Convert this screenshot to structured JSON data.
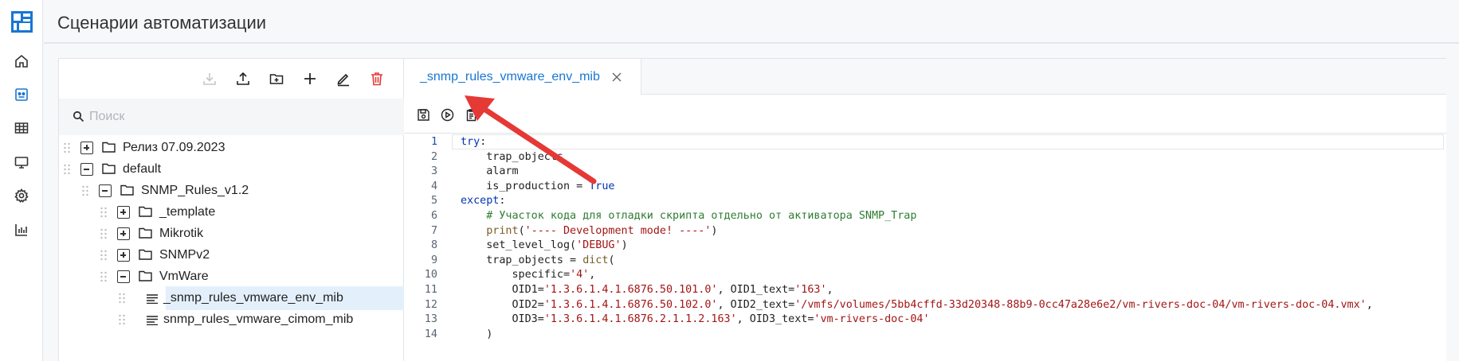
{
  "header": {
    "title": "Сценарии автоматизации"
  },
  "rail": {
    "items": [
      {
        "icon": "home-icon"
      },
      {
        "icon": "scripts-icon",
        "active": true
      },
      {
        "icon": "table-icon"
      },
      {
        "icon": "monitor-icon"
      },
      {
        "icon": "gear-icon"
      },
      {
        "icon": "chart-icon"
      }
    ]
  },
  "tree_toolbar": {
    "buttons": [
      "download-icon",
      "upload-icon",
      "new-folder-icon",
      "add-icon",
      "edit-icon",
      "delete-icon"
    ]
  },
  "search": {
    "placeholder": "Поиск"
  },
  "tree": {
    "items": [
      {
        "label": "Релиз 07.09.2023",
        "depth": 0,
        "expanded": false,
        "type": "folder"
      },
      {
        "label": "default",
        "depth": 0,
        "expanded": true,
        "type": "folder"
      },
      {
        "label": "SNMP_Rules_v1.2",
        "depth": 1,
        "expanded": true,
        "type": "folder"
      },
      {
        "label": "_template",
        "depth": 2,
        "expanded": false,
        "type": "folder"
      },
      {
        "label": "Mikrotik",
        "depth": 2,
        "expanded": false,
        "type": "folder"
      },
      {
        "label": "SNMPv2",
        "depth": 2,
        "expanded": false,
        "type": "folder"
      },
      {
        "label": "VmWare",
        "depth": 2,
        "expanded": true,
        "type": "folder"
      },
      {
        "label": "_snmp_rules_vmware_env_mib",
        "depth": 3,
        "type": "file",
        "selected": true
      },
      {
        "label": "snmp_rules_vmware_cimom_mib",
        "depth": 3,
        "type": "file"
      }
    ]
  },
  "editor": {
    "tab": {
      "label": "_snmp_rules_vmware_env_mib"
    },
    "toolbar": [
      "save-icon",
      "run-icon",
      "clipboard-icon"
    ],
    "current_line": 1,
    "lines": [
      {
        "n": "1",
        "code": "try:"
      },
      {
        "n": "2",
        "code": "    trap_objects"
      },
      {
        "n": "3",
        "code": "    alarm"
      },
      {
        "n": "4",
        "code": "    is_production = True"
      },
      {
        "n": "5",
        "code": "except:"
      },
      {
        "n": "6",
        "code": "    # Участок кода для отладки скрипта отдельно от активатора SNMP_Trap"
      },
      {
        "n": "7",
        "code": "    print('---- Development mode! ----')"
      },
      {
        "n": "8",
        "code": "    set_level_log('DEBUG')"
      },
      {
        "n": "9",
        "code": "    trap_objects = dict("
      },
      {
        "n": "10",
        "code": "        specific='4',"
      },
      {
        "n": "11",
        "code": "        OID1='1.3.6.1.4.1.6876.50.101.0', OID1_text='163',"
      },
      {
        "n": "12",
        "code": "        OID2='1.3.6.1.4.1.6876.50.102.0', OID2_text='/vmfs/volumes/5bb4cffd-33d20348-88b9-0cc47a28e6e2/vm-rivers-doc-04/vm-rivers-doc-04.vmx',"
      },
      {
        "n": "13",
        "code": "        OID3='1.3.6.1.4.1.6876.2.1.1.2.163', OID3_text='vm-rivers-doc-04'"
      },
      {
        "n": "14",
        "code": "    )"
      }
    ]
  },
  "colors": {
    "accent": "#1976d2",
    "delete": "#e53935",
    "arrow": "#e53935"
  }
}
